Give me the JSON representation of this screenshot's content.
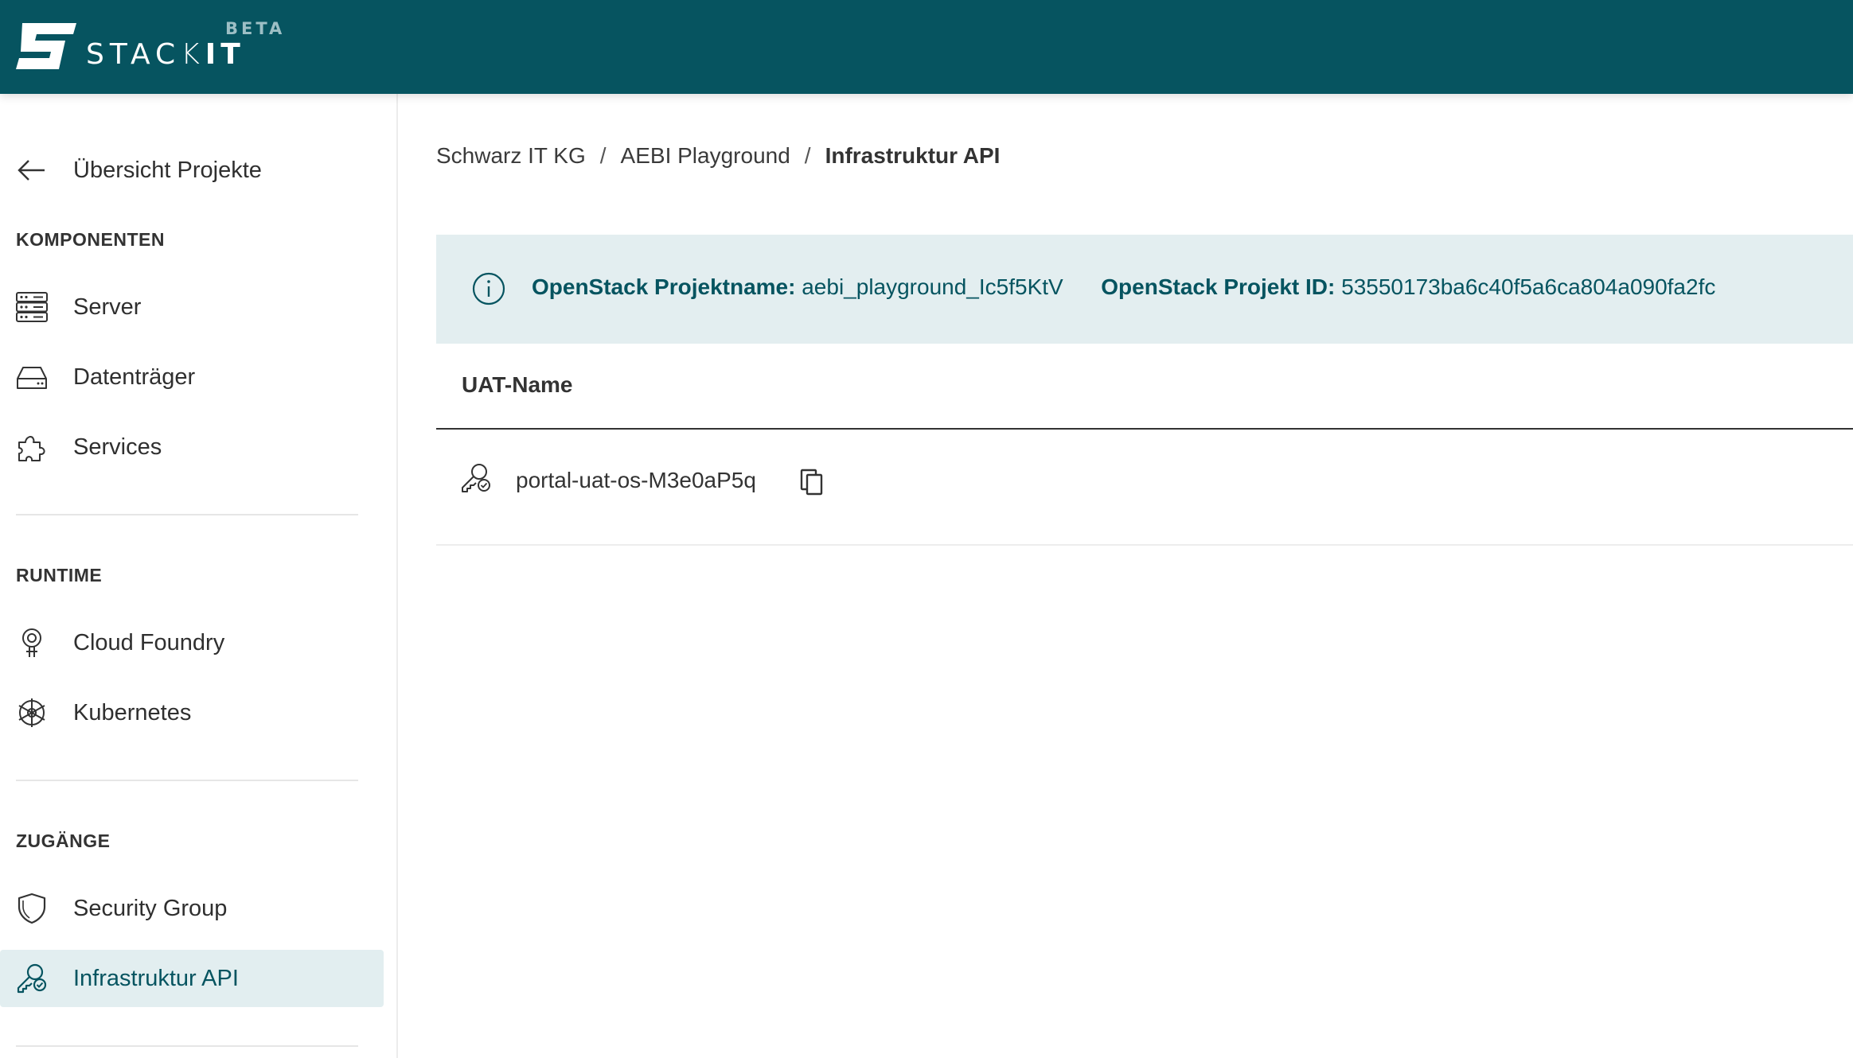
{
  "header": {
    "brand_light": "STAC",
    "brand_bracket": "K",
    "brand_bold": "IT",
    "badge": "BETA",
    "bg_color": "#065460"
  },
  "sidebar": {
    "back_label": "Übersicht Projekte",
    "sections": [
      {
        "title": "KOMPONENTEN",
        "items": [
          {
            "label": "Server",
            "icon": "server-icon"
          },
          {
            "label": "Datenträger",
            "icon": "hard-drive-icon"
          },
          {
            "label": "Services",
            "icon": "puzzle-icon"
          }
        ]
      },
      {
        "title": "RUNTIME",
        "items": [
          {
            "label": "Cloud Foundry",
            "icon": "cloud-foundry-icon"
          },
          {
            "label": "Kubernetes",
            "icon": "kubernetes-icon"
          }
        ]
      },
      {
        "title": "ZUGÄNGE",
        "items": [
          {
            "label": "Security Group",
            "icon": "shield-icon"
          },
          {
            "label": "Infrastruktur API",
            "icon": "key-user-icon",
            "active": true
          }
        ]
      }
    ]
  },
  "breadcrumb": {
    "org": "Schwarz IT KG",
    "project": "AEBI Playground",
    "current": "Infrastruktur API",
    "separator": "/"
  },
  "info": {
    "name_label": "OpenStack Projektname:",
    "name_value": "aebi_playground_Ic5f5KtV",
    "id_label": "OpenStack Projekt ID:",
    "id_value": "53550173ba6c40f5a6ca804a090fa2fc"
  },
  "table": {
    "column_header": "UAT-Name",
    "rows": [
      {
        "name": "portal-uat-os-M3e0aP5q"
      }
    ]
  },
  "colors": {
    "accent": "#065460",
    "active_bg": "#e2eef0",
    "banner_bg": "#e3eef0"
  }
}
